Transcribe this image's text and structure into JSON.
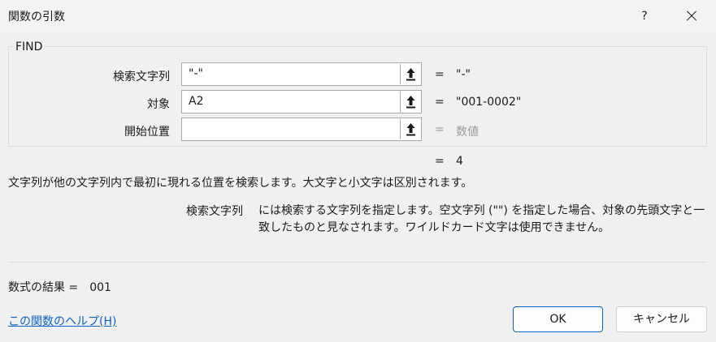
{
  "window": {
    "title": "関数の引数",
    "help_label": "?"
  },
  "function": {
    "name": "FIND",
    "args": [
      {
        "label": "検索文字列",
        "value": "\"-\"",
        "result": "\"-\""
      },
      {
        "label": "対象",
        "value": "A2",
        "result": "\"001-0002\""
      },
      {
        "label": "開始位置",
        "value": "",
        "result": "数値"
      }
    ],
    "equals": "=",
    "overall_result": "4",
    "description": "文字列が他の文字列内で最初に現れる位置を検索します。大文字と小文字は区別されます。",
    "current_arg_name": "検索文字列",
    "current_arg_desc": "には検索する文字列を指定します。空文字列 (\"\") を指定した場合、対象の先頭文字と一致したものと見なされます。ワイルドカード文字は使用できません。"
  },
  "footer": {
    "formula_result_label": "数式の結果 =",
    "formula_result_value": "001",
    "help_link": "この関数のヘルプ(H)",
    "ok_label": "OK",
    "cancel_label": "キャンセル"
  },
  "icons": {
    "collapse": "collapse-dialog-icon",
    "close": "close-icon"
  },
  "colors": {
    "link": "#0b62c4",
    "accent": "#0b62c4",
    "placeholder_result": "#9a9a9a"
  }
}
